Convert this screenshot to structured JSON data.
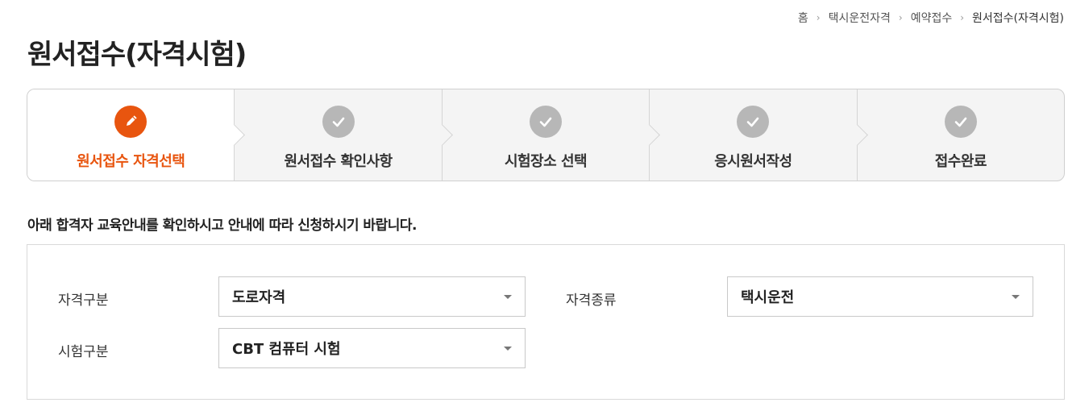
{
  "breadcrumb": {
    "items": [
      "홈",
      "택시운전자격",
      "예약접수",
      "원서접수(자격시험)"
    ],
    "separator": "›"
  },
  "page": {
    "title": "원서접수(자격시험)"
  },
  "steps": [
    {
      "label": "원서접수 자격선택",
      "icon": "pencil-icon",
      "active": true
    },
    {
      "label": "원서접수 확인사항",
      "icon": "check-icon",
      "active": false
    },
    {
      "label": "시험장소 선택",
      "icon": "check-icon",
      "active": false
    },
    {
      "label": "응시원서작성",
      "icon": "check-icon",
      "active": false
    },
    {
      "label": "접수완료",
      "icon": "check-icon",
      "active": false
    }
  ],
  "guide_text": "아래 합격자 교육안내를 확인하시고 안내에 따라 신청하시기 바랍니다.",
  "form": {
    "qualification_category": {
      "label": "자격구분",
      "value": "도로자격"
    },
    "qualification_type": {
      "label": "자격종류",
      "value": "택시운전"
    },
    "exam_category": {
      "label": "시험구분",
      "value": "CBT 컴퓨터 시험"
    }
  },
  "colors": {
    "accent": "#e8550f",
    "step_inactive_bg": "#f4f4f4",
    "check_circle": "#b7b7b7"
  }
}
